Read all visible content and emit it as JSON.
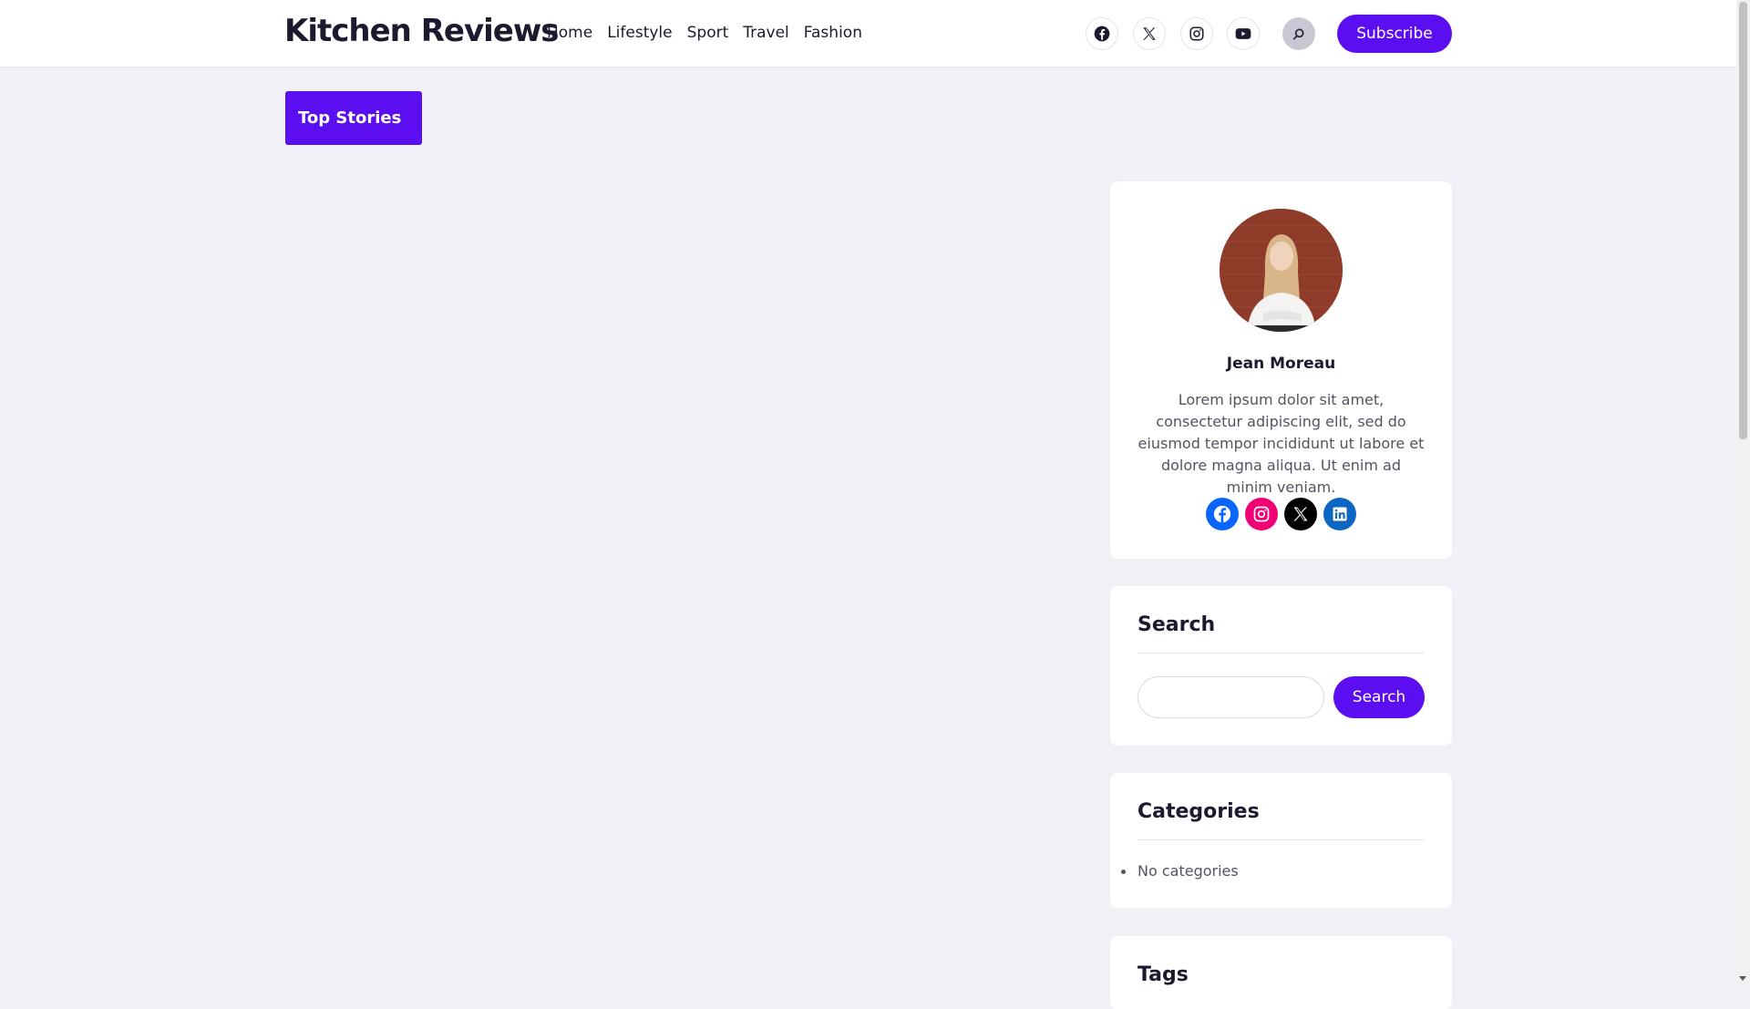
{
  "header": {
    "site_title": "Kitchen Reviews",
    "nav": [
      {
        "label": "Home"
      },
      {
        "label": "Lifestyle"
      },
      {
        "label": "Sport"
      },
      {
        "label": "Travel"
      },
      {
        "label": "Fashion"
      }
    ],
    "social_icons": [
      "facebook-icon",
      "x-icon",
      "instagram-icon",
      "youtube-icon"
    ],
    "search_icon": "search-icon",
    "subscribe_label": "Subscribe"
  },
  "main": {
    "top_stories_label": "Top Stories"
  },
  "sidebar": {
    "author": {
      "name": "Jean Moreau",
      "bio": "Lorem ipsum dolor sit amet, consectetur adipiscing elit, sed do eiusmod tempor incididunt ut labore et dolore magna aliqua. Ut enim ad minim veniam.",
      "socials": [
        {
          "icon": "facebook-icon",
          "color": "#0866ff"
        },
        {
          "icon": "instagram-icon",
          "color": "#f00075"
        },
        {
          "icon": "x-icon",
          "color": "#000000"
        },
        {
          "icon": "linkedin-icon",
          "color": "#0d66c2"
        }
      ]
    },
    "search": {
      "heading": "Search",
      "input_value": "",
      "button_label": "Search"
    },
    "categories": {
      "heading": "Categories",
      "items": [
        "No categories"
      ]
    },
    "tags": {
      "heading": "Tags"
    }
  },
  "colors": {
    "accent": "#5b0ef0",
    "page_background": "#f1f0f7",
    "text_dark": "#1c1a2e",
    "text_muted": "#55535f"
  }
}
